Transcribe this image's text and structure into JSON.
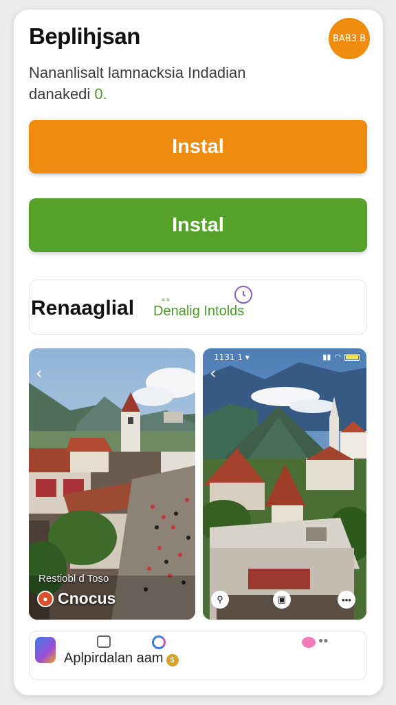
{
  "header": {
    "title": "Beplihjsan",
    "badge_label": "BAB3 B"
  },
  "description": {
    "line1": "Nananlisalt lamnacksia Indadian",
    "line2_prefix": "danakedi ",
    "line2_accent": "0."
  },
  "buttons": {
    "install_primary": "Instal",
    "install_secondary": "Instal"
  },
  "recommendation": {
    "title": "Renaaglial",
    "tiny_label": "≡ ≡",
    "subtitle": "Denalig Intolds",
    "icon": "clock-icon"
  },
  "screenshots": {
    "left": {
      "caption": "Restiobl d Toso",
      "label": "Cnocus",
      "back_icon": "chevron-left-icon"
    },
    "right": {
      "status_time": "1131 1 ▾",
      "back_icon": "chevron-left-icon",
      "action_icons": [
        "location-icon",
        "lock-icon",
        "more-icon"
      ]
    }
  },
  "footer": {
    "text": "Aplpirdalan aam",
    "coin_glyph": "$"
  },
  "colors": {
    "orange": "#ef8b10",
    "green": "#56a12a",
    "accent_text": "#4c9a2a"
  }
}
